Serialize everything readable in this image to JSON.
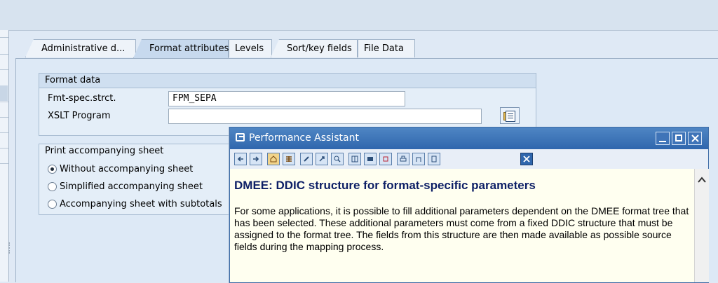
{
  "tabs": [
    {
      "label": "Administrative d..."
    },
    {
      "label": "Format attributes"
    },
    {
      "label": "Levels"
    },
    {
      "label": "Sort/key fields"
    },
    {
      "label": "File Data"
    }
  ],
  "format_data": {
    "title": "Format data",
    "fmt_spec_label": "Fmt-spec.strct.",
    "fmt_spec_value": "FPM_SEPA",
    "xslt_label": "XSLT Program",
    "xslt_value": ""
  },
  "print_sheet": {
    "title": "Print accompanying sheet",
    "options": [
      {
        "label": "Without accompanying sheet",
        "selected": true
      },
      {
        "label": "Simplified accompanying sheet",
        "selected": false
      },
      {
        "label": "Accompanying sheet with subtotals",
        "selected": false
      }
    ]
  },
  "popup": {
    "title": "Performance Assistant",
    "heading": "DMEE: DDIC structure for format-specific parameters",
    "body": "For some applications, it is possible to fill additional parameters dependent on the DMEE format tree that has been selected. These additional parameters must come from a fixed DDIC structure that must be assigned to the format tree. The fields from this structure are then made available as possible source fields during the mapping process.",
    "toolbar_icons": [
      "back-arrow-icon",
      "forward-arrow-icon",
      "home-icon",
      "structure-icon",
      "edit-icon",
      "link-icon",
      "search-icon",
      "book-icon",
      "bookmark-icon",
      "settings-icon",
      "print-icon",
      "export-icon",
      "document-icon",
      "close-icon"
    ]
  },
  "colors": {
    "title_bar": "#2f66ad",
    "heading": "#0d1f66",
    "body_bg": "#fffff0"
  }
}
